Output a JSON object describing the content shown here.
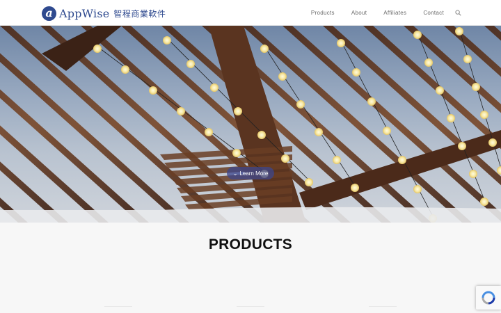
{
  "brand": {
    "logo_mark": "a",
    "name": "AppWise",
    "tagline_cn": "智程商業軟件",
    "color": "#2f4a8f"
  },
  "nav": {
    "items": [
      {
        "label": "Products"
      },
      {
        "label": "About"
      },
      {
        "label": "Affiliates"
      },
      {
        "label": "Contact"
      }
    ],
    "search_icon": "search-icon"
  },
  "hero": {
    "button_label": "Learn More",
    "button_icon": "chevron-down-icon"
  },
  "section": {
    "title": "PRODUCTS"
  },
  "widgets": {
    "recaptcha_icon": "recaptcha-icon"
  }
}
